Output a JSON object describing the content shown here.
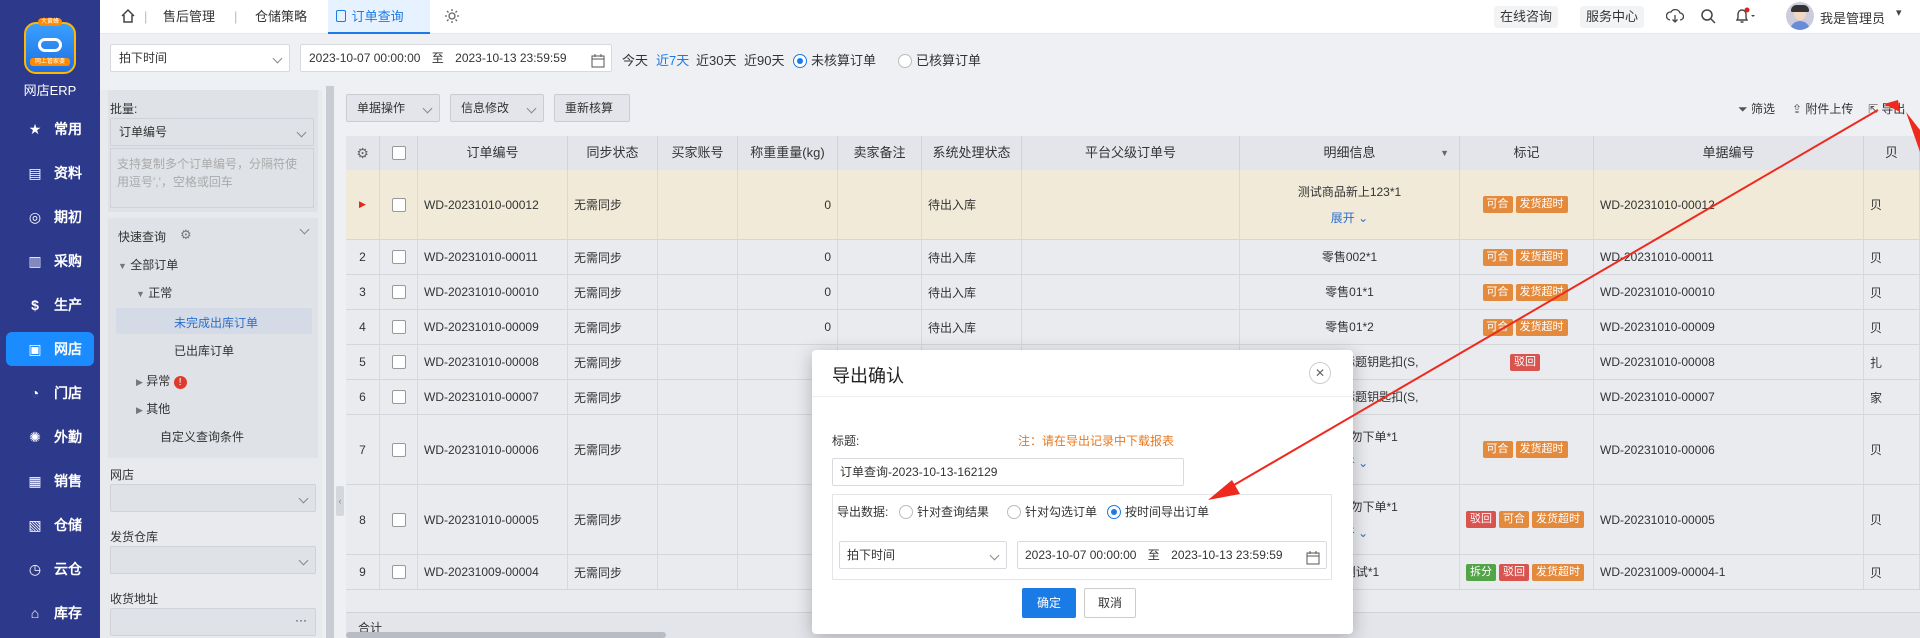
{
  "nav": {
    "app_name": "网店ERP",
    "logo_top": "大黄蜂",
    "logo_sub": "网上管家婆",
    "items": [
      {
        "label": "常用",
        "icon": "star-icon"
      },
      {
        "label": "资料",
        "icon": "document-icon"
      },
      {
        "label": "期初",
        "icon": "target-icon"
      },
      {
        "label": "采购",
        "icon": "chart-icon"
      },
      {
        "label": "生产",
        "icon": "dollar-icon"
      },
      {
        "label": "网店",
        "icon": "store-icon",
        "active": true
      },
      {
        "label": "门店",
        "icon": "pie-icon"
      },
      {
        "label": "外勤",
        "icon": "gear-icon"
      },
      {
        "label": "销售",
        "icon": "bars-icon"
      },
      {
        "label": "仓储",
        "icon": "box-icon"
      },
      {
        "label": "云仓",
        "icon": "clock-icon"
      },
      {
        "label": "库存",
        "icon": "home-icon"
      }
    ]
  },
  "topbar": {
    "tabs": [
      "售后管理",
      "仓储策略",
      "订单查询"
    ],
    "consult": "在线咨询",
    "service": "服务中心",
    "user": "我是管理员"
  },
  "filter": {
    "time_type": "拍下时间",
    "date_from": "2023-10-07 00:00:00",
    "date_sep": "至",
    "date_to": "2023-10-13 23:59:59",
    "quick": [
      "今天",
      "近7天",
      "近30天",
      "近90天"
    ],
    "radio1": "未核算订单",
    "radio2": "已核算订单"
  },
  "left": {
    "batch_label": "批量:",
    "batch_select": "订单编号",
    "batch_hint": "支持复制多个订单编号，分隔符使用逗号','，空格或回车",
    "quick_query": "快速查询",
    "tree": [
      "全部订单",
      "正常",
      "未完成出库订单",
      "已出库订单",
      "异常",
      "其他",
      "自定义查询条件"
    ],
    "shop_label": "网店",
    "warehouse_label": "发货仓库",
    "address_label": "收货地址",
    "address_more": "···"
  },
  "toolbar": {
    "batch_op": "单据操作",
    "info_edit": "信息修改",
    "recalc": "重新核算",
    "filter": "筛选",
    "attach": "附件上传",
    "export": "导出"
  },
  "table": {
    "headers": [
      "",
      "",
      "订单编号",
      "同步状态",
      "买家账号",
      "称重重量(kg)",
      "卖家备注",
      "系统处理状态",
      "平台父级订单号",
      "明细信息",
      "标记",
      "单据编号",
      "贝"
    ],
    "rows": [
      {
        "no": "",
        "order": "WD-20231010-00012",
        "sync": "无需同步",
        "weight": "0",
        "status": "待出入库",
        "detail": "测试商品新上123*1",
        "expand": "展开",
        "marks": [
          "可合",
          "发货超时"
        ],
        "doc": "WD-20231010-00012",
        "tail": "贝"
      },
      {
        "no": "2",
        "order": "WD-20231010-00011",
        "sync": "无需同步",
        "weight": "0",
        "status": "待出入库",
        "detail": "零售002*1",
        "expand": "",
        "marks": [
          "可合",
          "发货超时"
        ],
        "doc": "WD-20231010-00011",
        "tail": "贝"
      },
      {
        "no": "3",
        "order": "WD-20231010-00010",
        "sync": "无需同步",
        "weight": "0",
        "status": "待出入库",
        "detail": "零售01*1",
        "expand": "",
        "marks": [
          "可合",
          "发货超时"
        ],
        "doc": "WD-20231010-00010",
        "tail": "贝"
      },
      {
        "no": "4",
        "order": "WD-20231010-00009",
        "sync": "无需同步",
        "weight": "0",
        "status": "待出入库",
        "detail": "零售01*2",
        "expand": "",
        "marks": [
          "可合",
          "发货超时"
        ],
        "doc": "WD-20231010-00009",
        "tail": "贝"
      },
      {
        "no": "5",
        "order": "WD-20231010-00008",
        "sync": "无需同步",
        "weight": "",
        "status": "",
        "detail": "拍】ssl商品标题钥匙扣(S,",
        "expand": "",
        "marks": [
          "驳回"
        ],
        "doc": "WD-20231010-00008",
        "tail": "扎"
      },
      {
        "no": "6",
        "order": "WD-20231010-00007",
        "sync": "无需同步",
        "weight": "",
        "status": "",
        "detail": "拍】ssl商品标题钥匙扣(S,",
        "expand": "",
        "marks": [],
        "doc": "WD-20231010-00007",
        "tail": "家"
      },
      {
        "no": "7",
        "order": "WD-20231010-00006",
        "sync": "无需同步",
        "weight": "",
        "status": "",
        "detail": "改123-4_勿下单*1",
        "expand": "展开",
        "marks": [
          "可合",
          "发货超时"
        ],
        "doc": "WD-20231010-00006",
        "tail": "贝"
      },
      {
        "no": "8",
        "order": "WD-20231010-00005",
        "sync": "无需同步",
        "weight": "",
        "status": "",
        "detail": "改123-4_勿下单*1",
        "expand": "展开",
        "marks": [
          "驳回",
          "可合",
          "发货超时"
        ],
        "doc": "WD-20231010-00005",
        "tail": "贝"
      },
      {
        "no": "9",
        "order": "WD-20231009-00004",
        "sync": "无需同步",
        "weight": "",
        "status": "",
        "detail": "货位测试*1",
        "expand": "",
        "marks": [
          "拆分",
          "驳回",
          "发货超时"
        ],
        "doc": "WD-20231009-00004-1",
        "tail": "贝"
      }
    ],
    "total": "合计"
  },
  "dialog": {
    "title": "导出确认",
    "title_label": "标题:",
    "note": "注：请在导出记录中下载报表",
    "title_value": "订单查询-2023-10-13-162129",
    "export_label": "导出数据:",
    "opt1": "针对查询结果",
    "opt2": "针对勾选订单",
    "opt3": "按时间导出订单",
    "time_type": "拍下时间",
    "date_from": "2023-10-07 00:00:00",
    "date_sep": "至",
    "date_to": "2023-10-13 23:59:59",
    "confirm": "确定",
    "cancel": "取消"
  },
  "colors": {
    "nav_bg": "#2d3a8c",
    "accent": "#1a7ae6",
    "arrow": "#ee2a1f"
  }
}
